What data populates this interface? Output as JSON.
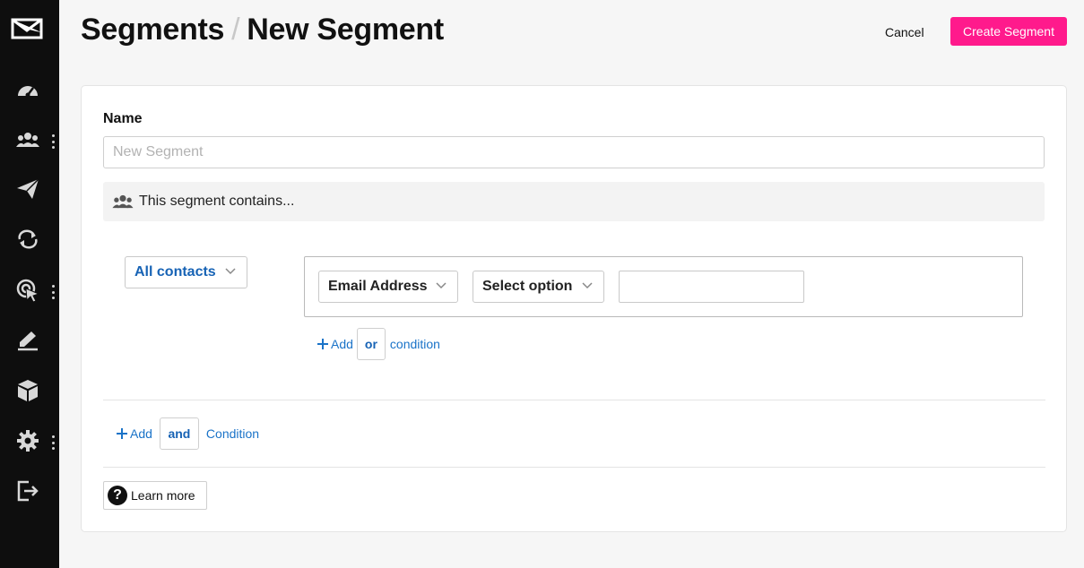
{
  "sidebar": {
    "items": [
      {
        "icon": "dashboard-gauge-icon",
        "has_menu": false
      },
      {
        "icon": "contacts-group-icon",
        "has_menu": true
      },
      {
        "icon": "paper-plane-icon",
        "has_menu": false
      },
      {
        "icon": "automation-loop-icon",
        "has_menu": false
      },
      {
        "icon": "target-cursor-icon",
        "has_menu": true
      },
      {
        "icon": "edit-pencil-icon",
        "has_menu": false
      },
      {
        "icon": "package-box-icon",
        "has_menu": false
      },
      {
        "icon": "settings-gear-icon",
        "has_menu": true
      },
      {
        "icon": "logout-icon",
        "has_menu": false
      }
    ]
  },
  "header": {
    "breadcrumb_parent": "Segments",
    "separator": "/",
    "current": "New Segment",
    "cancel_label": "Cancel",
    "create_label": "Create Segment"
  },
  "form": {
    "name_label": "Name",
    "name_value": "",
    "name_placeholder": "New Segment",
    "contains_text": "This segment contains...",
    "match_select": "All contacts",
    "condition": {
      "field": "Email Address",
      "operator": "Select option",
      "value": ""
    },
    "add_or": {
      "add": "Add",
      "logic": "or",
      "suffix": "condition"
    },
    "add_and": {
      "add": "Add",
      "logic": "and",
      "suffix": "Condition"
    },
    "learn_more": "Learn more"
  },
  "colors": {
    "accent": "#ff1a8c",
    "link": "#1763b5",
    "sidebar_bg": "#0e0e0e"
  }
}
